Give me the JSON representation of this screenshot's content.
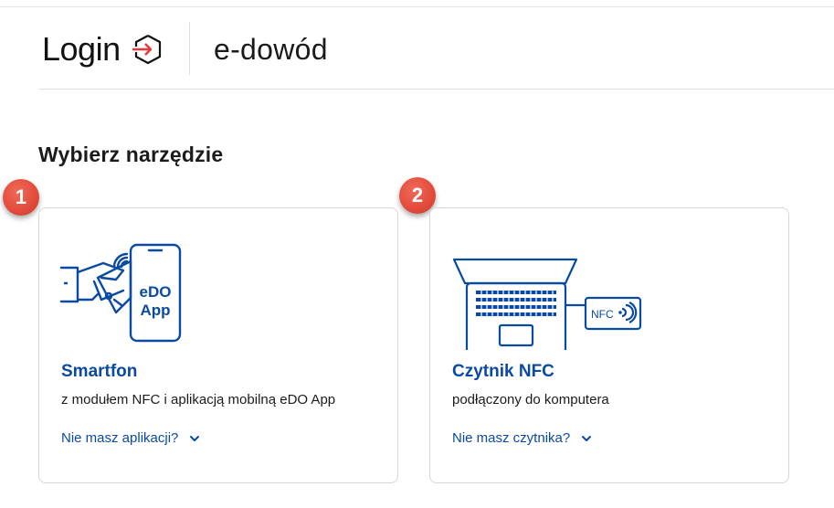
{
  "header": {
    "brand": "Login",
    "brand_icon": "login-arrow-icon",
    "service": "e-dowód"
  },
  "main": {
    "section_title": "Wybierz narzędzie",
    "options": [
      {
        "badge": "1",
        "title": "Smartfon",
        "description": "z modułem NFC i aplikacją mobilną eDO App",
        "link": "Nie masz aplikacji?",
        "illustration": "smartphone-edo-app-icon",
        "phone_text_line1": "eDO",
        "phone_text_line2": "App"
      },
      {
        "badge": "2",
        "title": "Czytnik NFC",
        "description": "podłączony do komputera",
        "link": "Nie masz czytnika?",
        "illustration": "laptop-nfc-reader-icon",
        "reader_text": "NFC"
      }
    ]
  },
  "colors": {
    "accent_blue": "#0b4aa2",
    "illustration_blue": "#0b4aa2",
    "badge_red": "#e24a3a",
    "logo_red": "#e8363b"
  }
}
